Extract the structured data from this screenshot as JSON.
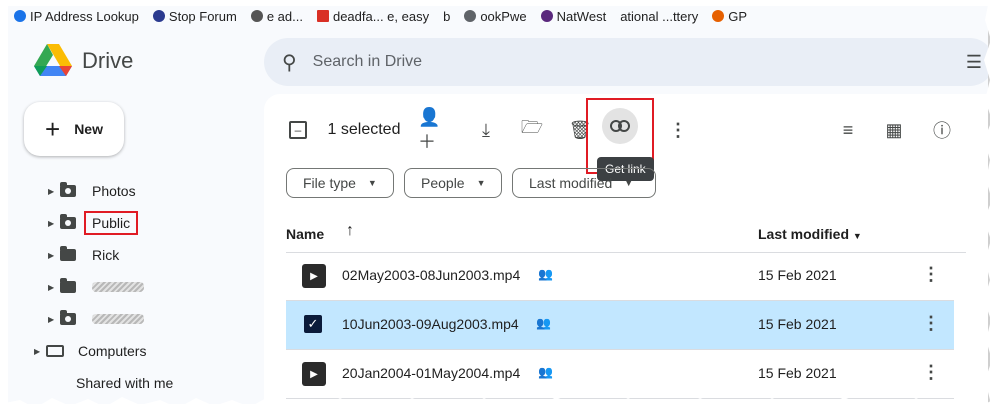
{
  "bookmarks": [
    {
      "label": "IP Address Lookup",
      "icon": "globe-icon",
      "color": "#1a73e8"
    },
    {
      "label": "Stop Forum",
      "icon": "shield-icon",
      "color": "#2b3a8f"
    },
    {
      "label": "e ad...",
      "icon": "swirl-icon",
      "color": "#555555"
    },
    {
      "label": "deadfa... e, easy",
      "icon": "bookmark-icon",
      "color": "#d93025"
    },
    {
      "label": "b",
      "icon": "blank-icon",
      "color": "#999999"
    },
    {
      "label": "ookPwe",
      "icon": "pwned-icon",
      "color": "#5f6368"
    },
    {
      "label": "NatWest",
      "icon": "natwest-icon",
      "color": "#5a287d"
    },
    {
      "label": "ational ...ttery",
      "icon": "lottery-icon",
      "color": "#999999"
    },
    {
      "label": "GP",
      "icon": "firefox-icon",
      "color": "#e66000"
    }
  ],
  "app": {
    "name": "Drive"
  },
  "search": {
    "placeholder": "Search in Drive"
  },
  "new_button": {
    "label": "New"
  },
  "sidebar": {
    "items": [
      {
        "label": "Photos",
        "type": "shared"
      },
      {
        "label": "Public",
        "type": "shared",
        "highlighted": true
      },
      {
        "label": "Rick",
        "type": "folder"
      },
      {
        "label": "",
        "type": "folder",
        "redacted": true
      },
      {
        "label": "",
        "type": "shared",
        "redacted": true
      }
    ],
    "computers": "Computers",
    "shared_with_me": "Shared with me"
  },
  "toolbar": {
    "selected_count": "1 selected",
    "tooltip": "Get link"
  },
  "filters": {
    "file_type": "File type",
    "people": "People",
    "last_modified": "Last modified"
  },
  "table": {
    "col_name": "Name",
    "col_modified": "Last modified",
    "rows": [
      {
        "name": "02May2003-08Jun2003.mp4",
        "modified": "15 Feb 2021",
        "selected": false
      },
      {
        "name": "10Jun2003-09Aug2003.mp4",
        "modified": "15 Feb 2021",
        "selected": true
      },
      {
        "name": "20Jan2004-01May2004.mp4",
        "modified": "15 Feb 2021",
        "selected": false
      }
    ]
  },
  "colors": {
    "highlight_box": "#e01b24",
    "selected_row": "#c2e7ff",
    "search_bg": "#e9eef6"
  }
}
